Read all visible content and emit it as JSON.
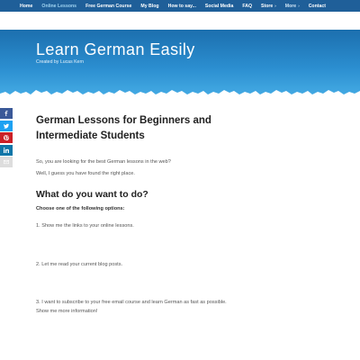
{
  "nav": {
    "items": [
      {
        "label": "Home",
        "active": false
      },
      {
        "label": "Online Lessons",
        "active": true
      },
      {
        "label": "Free German Course",
        "active": false
      },
      {
        "label": "My Blog",
        "active": false
      },
      {
        "label": "How to say...",
        "active": false
      },
      {
        "label": "Social Media",
        "active": false
      },
      {
        "label": "FAQ",
        "active": false
      },
      {
        "label": "Store",
        "active": false
      },
      {
        "label": "More",
        "active": false
      },
      {
        "label": "Contact",
        "active": false
      }
    ],
    "caret": "›"
  },
  "header": {
    "title": "Learn German Easily",
    "subtitle": "Created by Lucas Kern"
  },
  "share": {
    "buttons": [
      {
        "icon": "facebook-icon",
        "color": "#3b5998"
      },
      {
        "icon": "twitter-icon",
        "color": "#1da1f2"
      },
      {
        "icon": "pinterest-icon",
        "color": "#cb2027"
      },
      {
        "icon": "linkedin-icon",
        "color": "#0e76a8"
      },
      {
        "icon": "email-icon",
        "color": "#dddddd"
      }
    ]
  },
  "main": {
    "title_line1": "German Lessons for Beginners and",
    "title_line2": "Intermediate Students",
    "intro1": "So, you are looking for the best German lessons in the web?",
    "intro2": "Well, I guess you have found the right place.",
    "heading": "What do you want to do?",
    "options_label": "Choose one of the following options:",
    "option1": "1. Show me the links to your online lessons.",
    "option2": "2. Let me read your current blog posts.",
    "option3_line1": "3. I want to subscribe to your free email course and learn German as fast as possible.",
    "option3_line2": "Show me more information!"
  },
  "colors": {
    "nav_bg": "#1f5f99",
    "nav_active": "#9fd4f2",
    "banner_top": "#1c6fae",
    "banner_bottom": "#47aee6"
  }
}
